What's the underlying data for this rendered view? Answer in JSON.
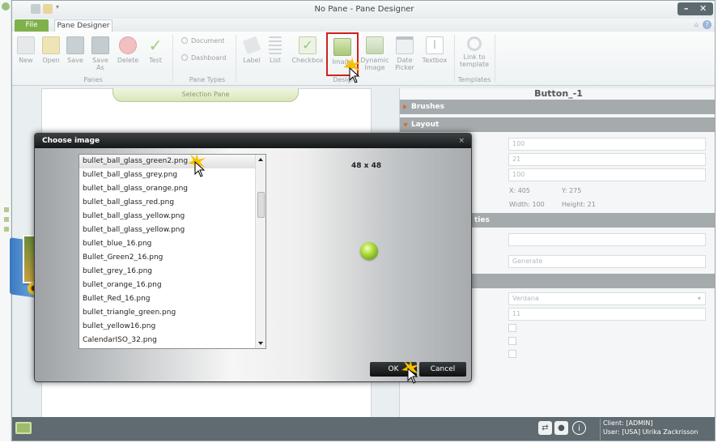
{
  "window": {
    "title": "No Pane - Pane Designer",
    "controls": [
      "–",
      "✕"
    ]
  },
  "tabs": {
    "file": "File",
    "pane_designer": "Pane Designer"
  },
  "ribbon": {
    "panes": {
      "group_label": "Panes",
      "buttons": [
        "New",
        "Open",
        "Save",
        "Save As",
        "Delete",
        "Test"
      ]
    },
    "pane_types": {
      "group_label": "Pane Types",
      "options": [
        "Document",
        "Dashboard"
      ]
    },
    "design": {
      "group_label": "Design",
      "buttons": [
        "Label",
        "List",
        "Checkbox",
        "Image",
        "Dynamic Image",
        "Date Picker",
        "Textbox"
      ]
    },
    "templates": {
      "group_label": "Templates",
      "buttons": [
        "Link to template"
      ]
    }
  },
  "canvas": {
    "selection_pane_label": "Selection Pane"
  },
  "properties": {
    "title": "Button_-1",
    "sections": [
      "Brushes",
      "Layout",
      "",
      ""
    ],
    "layout_values": [
      "100",
      "21",
      "100"
    ],
    "position": {
      "x": "X: 405",
      "y": "Y: 275",
      "width": "Width: 100",
      "height": "Height: 21"
    },
    "partial_section_text": "ties",
    "generate_placeholder": "Generate",
    "font_name": "Verdana",
    "font_size": "11"
  },
  "dialog": {
    "title": "Choose image",
    "close": "×",
    "preview_size": "48 x 48",
    "files": [
      "bullet_ball_glass_green2.png",
      "bullet_ball_glass_grey.png",
      "bullet_ball_glass_orange.png",
      "bullet_ball_glass_red.png",
      "bullet_ball_glass_yellow.png",
      "bullet_ball_glass_yellow.png",
      "bullet_blue_16.png",
      "Bullet_Green2_16.png",
      "bullet_grey_16.png",
      "bullet_orange_16.png",
      "Bullet_Red_16.png",
      "bullet_triangle_green.png",
      "bullet_yellow16.png",
      "CalendarISO_32.png"
    ],
    "selected_index": 0,
    "ok": "OK",
    "cancel": "Cancel"
  },
  "status": {
    "client": "Client: [ADMIN]",
    "user": "User: [USA] Ulrika Zackrisson"
  },
  "colors": {
    "accent_green": "#7fb04a",
    "highlight_red": "#d02020",
    "status_bar": "#5f6b70"
  }
}
